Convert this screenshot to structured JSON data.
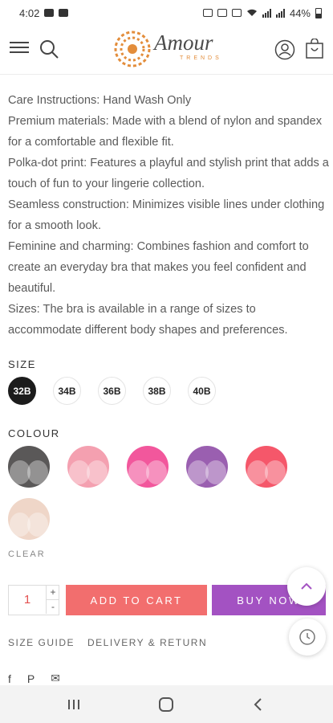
{
  "status_bar": {
    "time": "4:02",
    "battery": "44%"
  },
  "brand": {
    "name": "Amour",
    "tagline": "TRENDS",
    "colors": {
      "logo_orange": "#e38d3b",
      "add_to_cart": "#f26e6e",
      "buy_now": "#a352c2"
    }
  },
  "description": [
    "Care Instructions: Hand Wash Only",
    "Premium materials: Made with a blend of nylon and spandex for a comfortable and flexible fit.",
    "Polka-dot print: Features a playful and stylish print that adds a touch of fun to your lingerie collection.",
    "Seamless construction: Minimizes visible lines under clothing for a smooth look.",
    "Feminine and charming: Combines fashion and comfort to create an everyday bra that makes you feel confident and beautiful.",
    "Sizes: The bra is available in a range of sizes to accommodate different body shapes and preferences."
  ],
  "size": {
    "label": "SIZE",
    "options": [
      "32B",
      "34B",
      "36B",
      "38B",
      "40B"
    ],
    "selected": "32B"
  },
  "colour": {
    "label": "COLOUR",
    "swatches": [
      "#5a5858",
      "#f4a0b0",
      "#f2579c",
      "#9a5fb0",
      "#f5576a",
      "#efd6c8"
    ],
    "clear_label": "CLEAR"
  },
  "cart": {
    "quantity": "1",
    "plus": "+",
    "minus": "-",
    "add_to_cart": "ADD TO CART",
    "buy_now": "BUY NOW"
  },
  "links": {
    "size_guide": "SIZE GUIDE",
    "delivery_return": "DELIVERY & RETURN"
  },
  "social": {
    "facebook": "f",
    "pinterest": "P",
    "email": "✉"
  }
}
